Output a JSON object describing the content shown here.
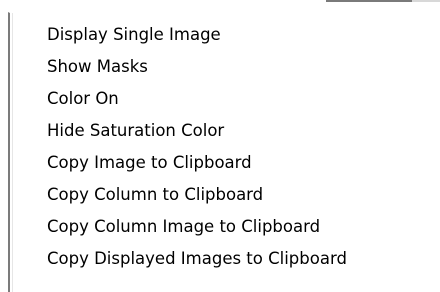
{
  "context_menu": {
    "items": [
      {
        "label": "Display Single Image"
      },
      {
        "label": "Show Masks"
      },
      {
        "label": "Color On"
      },
      {
        "label": "Hide Saturation Color"
      },
      {
        "label": "Copy Image to Clipboard"
      },
      {
        "label": "Copy Column to Clipboard"
      },
      {
        "label": "Copy Column Image to Clipboard"
      },
      {
        "label": "Copy Displayed Images to Clipboard"
      }
    ]
  },
  "colors": {
    "menu_background": "#ffffff",
    "menu_border": "#7b7b7b",
    "text": "#000000",
    "hover_highlight": "#316ac5"
  }
}
